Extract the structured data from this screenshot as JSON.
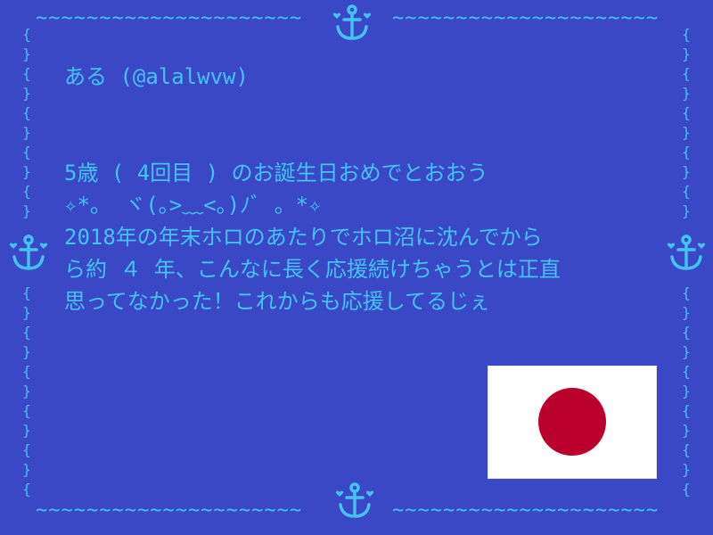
{
  "card": {
    "handle": "ある (@alalwvw)",
    "message_lines": [
      "5歳 ( 4回目 ) のお誕生日おめでとおおう",
      "✧*。 ヾ(｡>﹏<｡)ﾉﾞ 。*✧",
      "2018年の年末ホロのあたりでホロ沼に沈んでから",
      "ら約 ４ 年、こんなに長く応援続けちゃうとは正直",
      "思ってなかった！これからも応援してるじぇ"
    ]
  },
  "decoration": {
    "border_color": "#45c2f2",
    "background_color": "#3b48c6",
    "corner_icon": "anchor-icon",
    "heart_icon": "heart-icon"
  },
  "flag": {
    "icon": "japan-flag-icon",
    "field_color": "#ffffff",
    "disc_color": "#bc002d"
  }
}
